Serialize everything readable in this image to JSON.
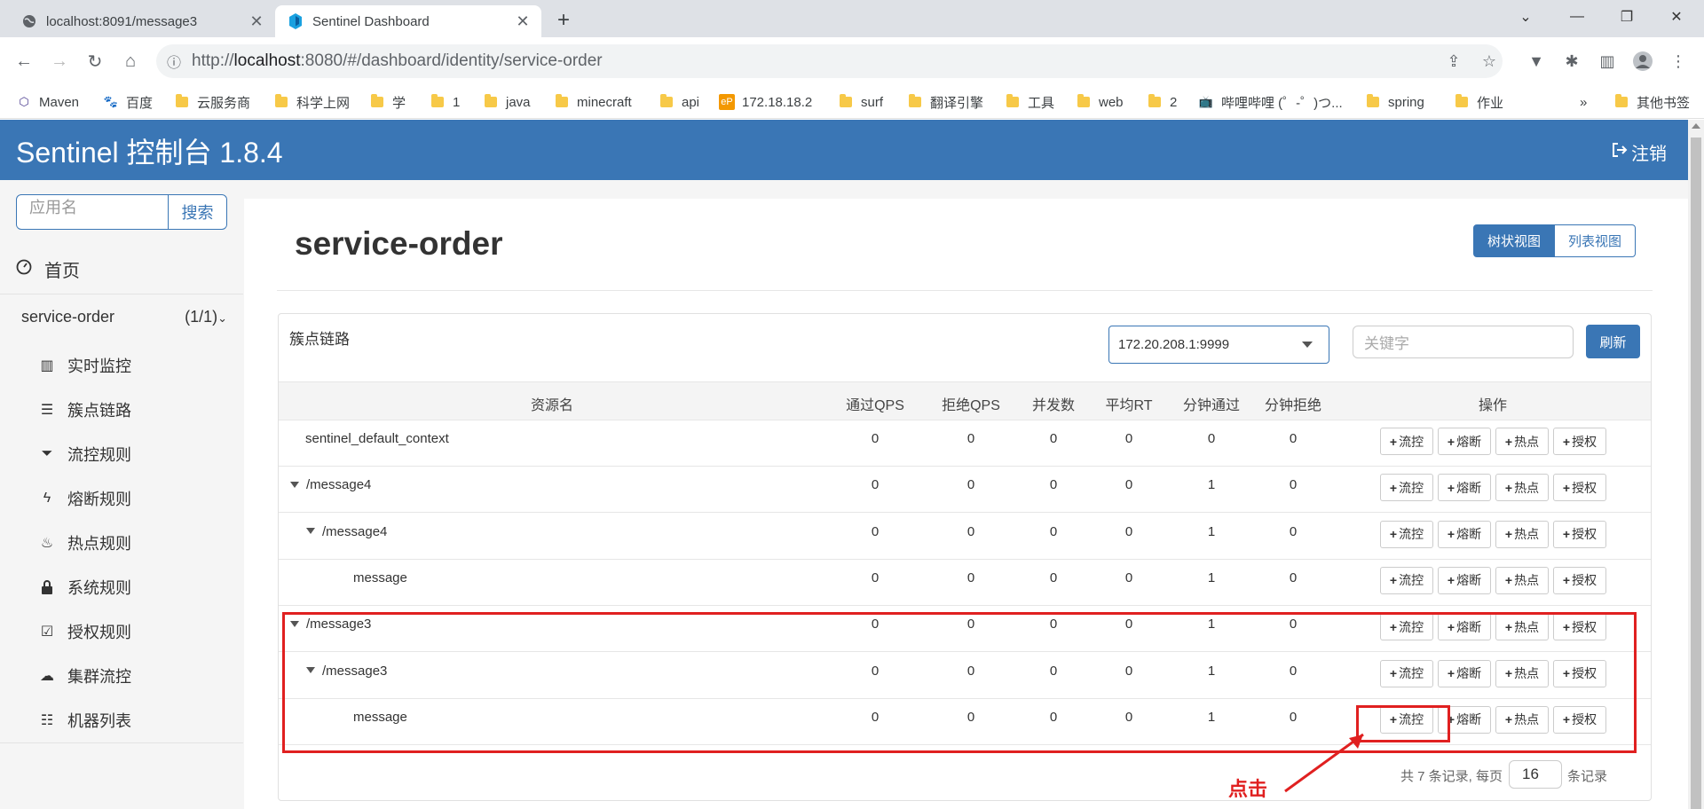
{
  "browser": {
    "tabs": [
      {
        "title": "localhost:8091/message3",
        "close": "✕"
      },
      {
        "title": "Sentinel Dashboard",
        "close": "✕"
      }
    ],
    "url_prefix": "http://",
    "url_host": "localhost",
    "url_rest": ":8080/#/dashboard/identity/service-order",
    "bookmarks": [
      "Maven",
      "百度",
      "云服务商",
      "科学上网",
      "学",
      "1",
      "java",
      "minecraft",
      "api",
      "172.18.18.2",
      "surf",
      "翻译引擎",
      "工具",
      "web",
      "2",
      "哔哩哔哩 (゜-゜)つ...",
      "spring",
      "作业"
    ],
    "bookmarks_more": "»",
    "other_bookmarks": "其他书签"
  },
  "app": {
    "title": "Sentinel 控制台 1.8.4",
    "logout": "注销"
  },
  "sidebar": {
    "search_placeholder": "应用名",
    "search_button": "搜索",
    "home": "首页",
    "app_name": "service-order",
    "app_count": "(1/1)",
    "items": [
      "实时监控",
      "簇点链路",
      "流控规则",
      "熔断规则",
      "热点规则",
      "系统规则",
      "授权规则",
      "集群流控",
      "机器列表"
    ]
  },
  "main": {
    "title": "service-order",
    "view_tree": "树状视图",
    "view_list": "列表视图",
    "panel_title": "簇点链路",
    "machine": "172.20.208.1:9999",
    "keyword_placeholder": "关键字",
    "refresh": "刷新",
    "columns": [
      "资源名",
      "通过QPS",
      "拒绝QPS",
      "并发数",
      "平均RT",
      "分钟通过",
      "分钟拒绝",
      "操作"
    ],
    "ops": [
      "流控",
      "熔断",
      "热点",
      "授权"
    ],
    "rows": [
      {
        "name": "sentinel_default_context",
        "level": 0,
        "expand": false,
        "pass_qps": "0",
        "block_qps": "0",
        "threads": "0",
        "avg_rt": "0",
        "min_pass": "0",
        "min_block": "0"
      },
      {
        "name": "/message4",
        "level": 0,
        "expand": true,
        "pass_qps": "0",
        "block_qps": "0",
        "threads": "0",
        "avg_rt": "0",
        "min_pass": "1",
        "min_block": "0"
      },
      {
        "name": "/message4",
        "level": 1,
        "expand": true,
        "pass_qps": "0",
        "block_qps": "0",
        "threads": "0",
        "avg_rt": "0",
        "min_pass": "1",
        "min_block": "0"
      },
      {
        "name": "message",
        "level": 2,
        "expand": false,
        "pass_qps": "0",
        "block_qps": "0",
        "threads": "0",
        "avg_rt": "0",
        "min_pass": "1",
        "min_block": "0"
      },
      {
        "name": "/message3",
        "level": 0,
        "expand": true,
        "pass_qps": "0",
        "block_qps": "0",
        "threads": "0",
        "avg_rt": "0",
        "min_pass": "1",
        "min_block": "0"
      },
      {
        "name": "/message3",
        "level": 1,
        "expand": true,
        "pass_qps": "0",
        "block_qps": "0",
        "threads": "0",
        "avg_rt": "0",
        "min_pass": "1",
        "min_block": "0"
      },
      {
        "name": "message",
        "level": 2,
        "expand": false,
        "pass_qps": "0",
        "block_qps": "0",
        "threads": "0",
        "avg_rt": "0",
        "min_pass": "1",
        "min_block": "0"
      }
    ],
    "pager_prefix": "共 7 条记录, 每页",
    "page_size": "16",
    "pager_suffix": "条记录"
  },
  "annotation": {
    "label": "点击",
    "color": "#e02020"
  },
  "colors": {
    "primary": "#3a76b5",
    "annotation": "#e02020"
  }
}
